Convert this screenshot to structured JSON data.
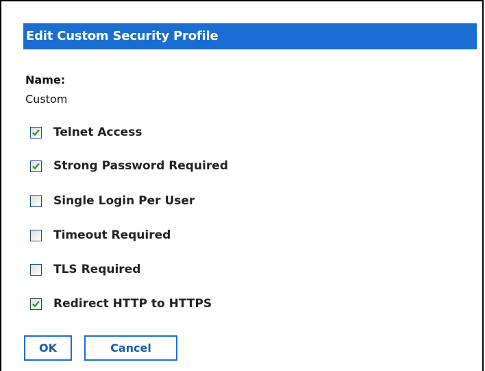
{
  "dialog": {
    "title": "Edit Custom Security Profile",
    "name_label": "Name:",
    "name_value": "Custom"
  },
  "options": [
    {
      "label": "Telnet Access",
      "checked": true
    },
    {
      "label": "Strong Password Required",
      "checked": true
    },
    {
      "label": "Single Login Per User",
      "checked": false
    },
    {
      "label": "Timeout Required",
      "checked": false
    },
    {
      "label": "TLS Required",
      "checked": false
    },
    {
      "label": "Redirect HTTP to HTTPS",
      "checked": true
    }
  ],
  "buttons": {
    "ok": "OK",
    "cancel": "Cancel"
  },
  "colors": {
    "title_bar": "#1a6ed1",
    "check_mark": "#21a121",
    "button_border": "#1a6ed1"
  }
}
